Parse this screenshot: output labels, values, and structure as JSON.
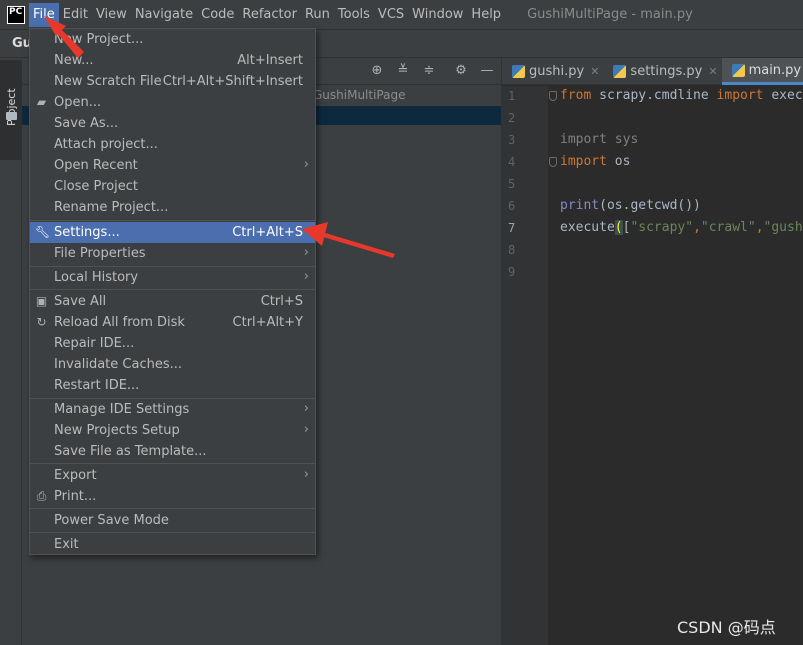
{
  "app": {
    "logo_text": "PC",
    "window_title": "GushiMultiPage - main.py"
  },
  "menubar": {
    "items": [
      "File",
      "Edit",
      "View",
      "Navigate",
      "Code",
      "Refactor",
      "Run",
      "Tools",
      "VCS",
      "Window",
      "Help"
    ]
  },
  "navbar": {
    "project": "Gu"
  },
  "toolstrip": {
    "project_label": "Project"
  },
  "project_panel": {
    "root_path": "GushiMultiPage"
  },
  "file_menu": {
    "items": [
      {
        "label": "New Project...",
        "shortcut": "",
        "submenu": false
      },
      {
        "label": "New...",
        "shortcut": "Alt+Insert",
        "submenu": false
      },
      {
        "label": "New Scratch File",
        "shortcut": "Ctrl+Alt+Shift+Insert",
        "submenu": false
      },
      {
        "label": "Open...",
        "shortcut": "",
        "submenu": false,
        "icon": "folder-open-icon"
      },
      {
        "label": "Save As...",
        "shortcut": "",
        "submenu": false
      },
      {
        "label": "Attach project...",
        "shortcut": "",
        "submenu": false
      },
      {
        "label": "Open Recent",
        "shortcut": "",
        "submenu": true
      },
      {
        "label": "Close Project",
        "shortcut": "",
        "submenu": false
      },
      {
        "label": "Rename Project...",
        "shortcut": "",
        "submenu": false
      },
      {
        "label": "Settings...",
        "shortcut": "Ctrl+Alt+S",
        "submenu": false,
        "icon": "wrench-icon",
        "selected": true
      },
      {
        "label": "File Properties",
        "shortcut": "",
        "submenu": true
      },
      {
        "label": "Local History",
        "shortcut": "",
        "submenu": true
      },
      {
        "label": "Save All",
        "shortcut": "Ctrl+S",
        "submenu": false,
        "icon": "save-icon"
      },
      {
        "label": "Reload All from Disk",
        "shortcut": "Ctrl+Alt+Y",
        "submenu": false,
        "icon": "reload-icon"
      },
      {
        "label": "Repair IDE...",
        "shortcut": "",
        "submenu": false
      },
      {
        "label": "Invalidate Caches...",
        "shortcut": "",
        "submenu": false
      },
      {
        "label": "Restart IDE...",
        "shortcut": "",
        "submenu": false
      },
      {
        "label": "Manage IDE Settings",
        "shortcut": "",
        "submenu": true
      },
      {
        "label": "New Projects Setup",
        "shortcut": "",
        "submenu": true
      },
      {
        "label": "Save File as Template...",
        "shortcut": "",
        "submenu": false
      },
      {
        "label": "Export",
        "shortcut": "",
        "submenu": true
      },
      {
        "label": "Print...",
        "shortcut": "",
        "submenu": false,
        "icon": "print-icon"
      },
      {
        "label": "Power Save Mode",
        "shortcut": "",
        "submenu": false
      },
      {
        "label": "Exit",
        "shortcut": "",
        "submenu": false
      }
    ]
  },
  "editor": {
    "tabs": [
      {
        "label": "gushi.py",
        "active": false
      },
      {
        "label": "settings.py",
        "active": false
      },
      {
        "label": "main.py",
        "active": true
      }
    ],
    "line_numbers": [
      "1",
      "2",
      "3",
      "4",
      "5",
      "6",
      "7",
      "8",
      "9"
    ],
    "code": {
      "l1_kw1": "from",
      "l1_mod": " scrapy.cmdline ",
      "l1_kw2": "import",
      "l1_name": " exec",
      "l3_kw": "import",
      "l3_mod": " sys",
      "l4_kw": "import",
      "l4_mod": " os",
      "l6_fn": "print",
      "l6_rest": "(os.getcwd())",
      "l7_fn": "execute",
      "l7_paren": "(",
      "l7_bracket": "[",
      "l7_s1": "\"scrapy\"",
      "l7_c1": ",",
      "l7_s2": "\"crawl\"",
      "l7_c2": ",",
      "l7_s3": "\"gush"
    }
  },
  "watermark": "CSDN @码点",
  "colors": {
    "accent": "#4b6eaf",
    "arrow": "#e8382c"
  }
}
